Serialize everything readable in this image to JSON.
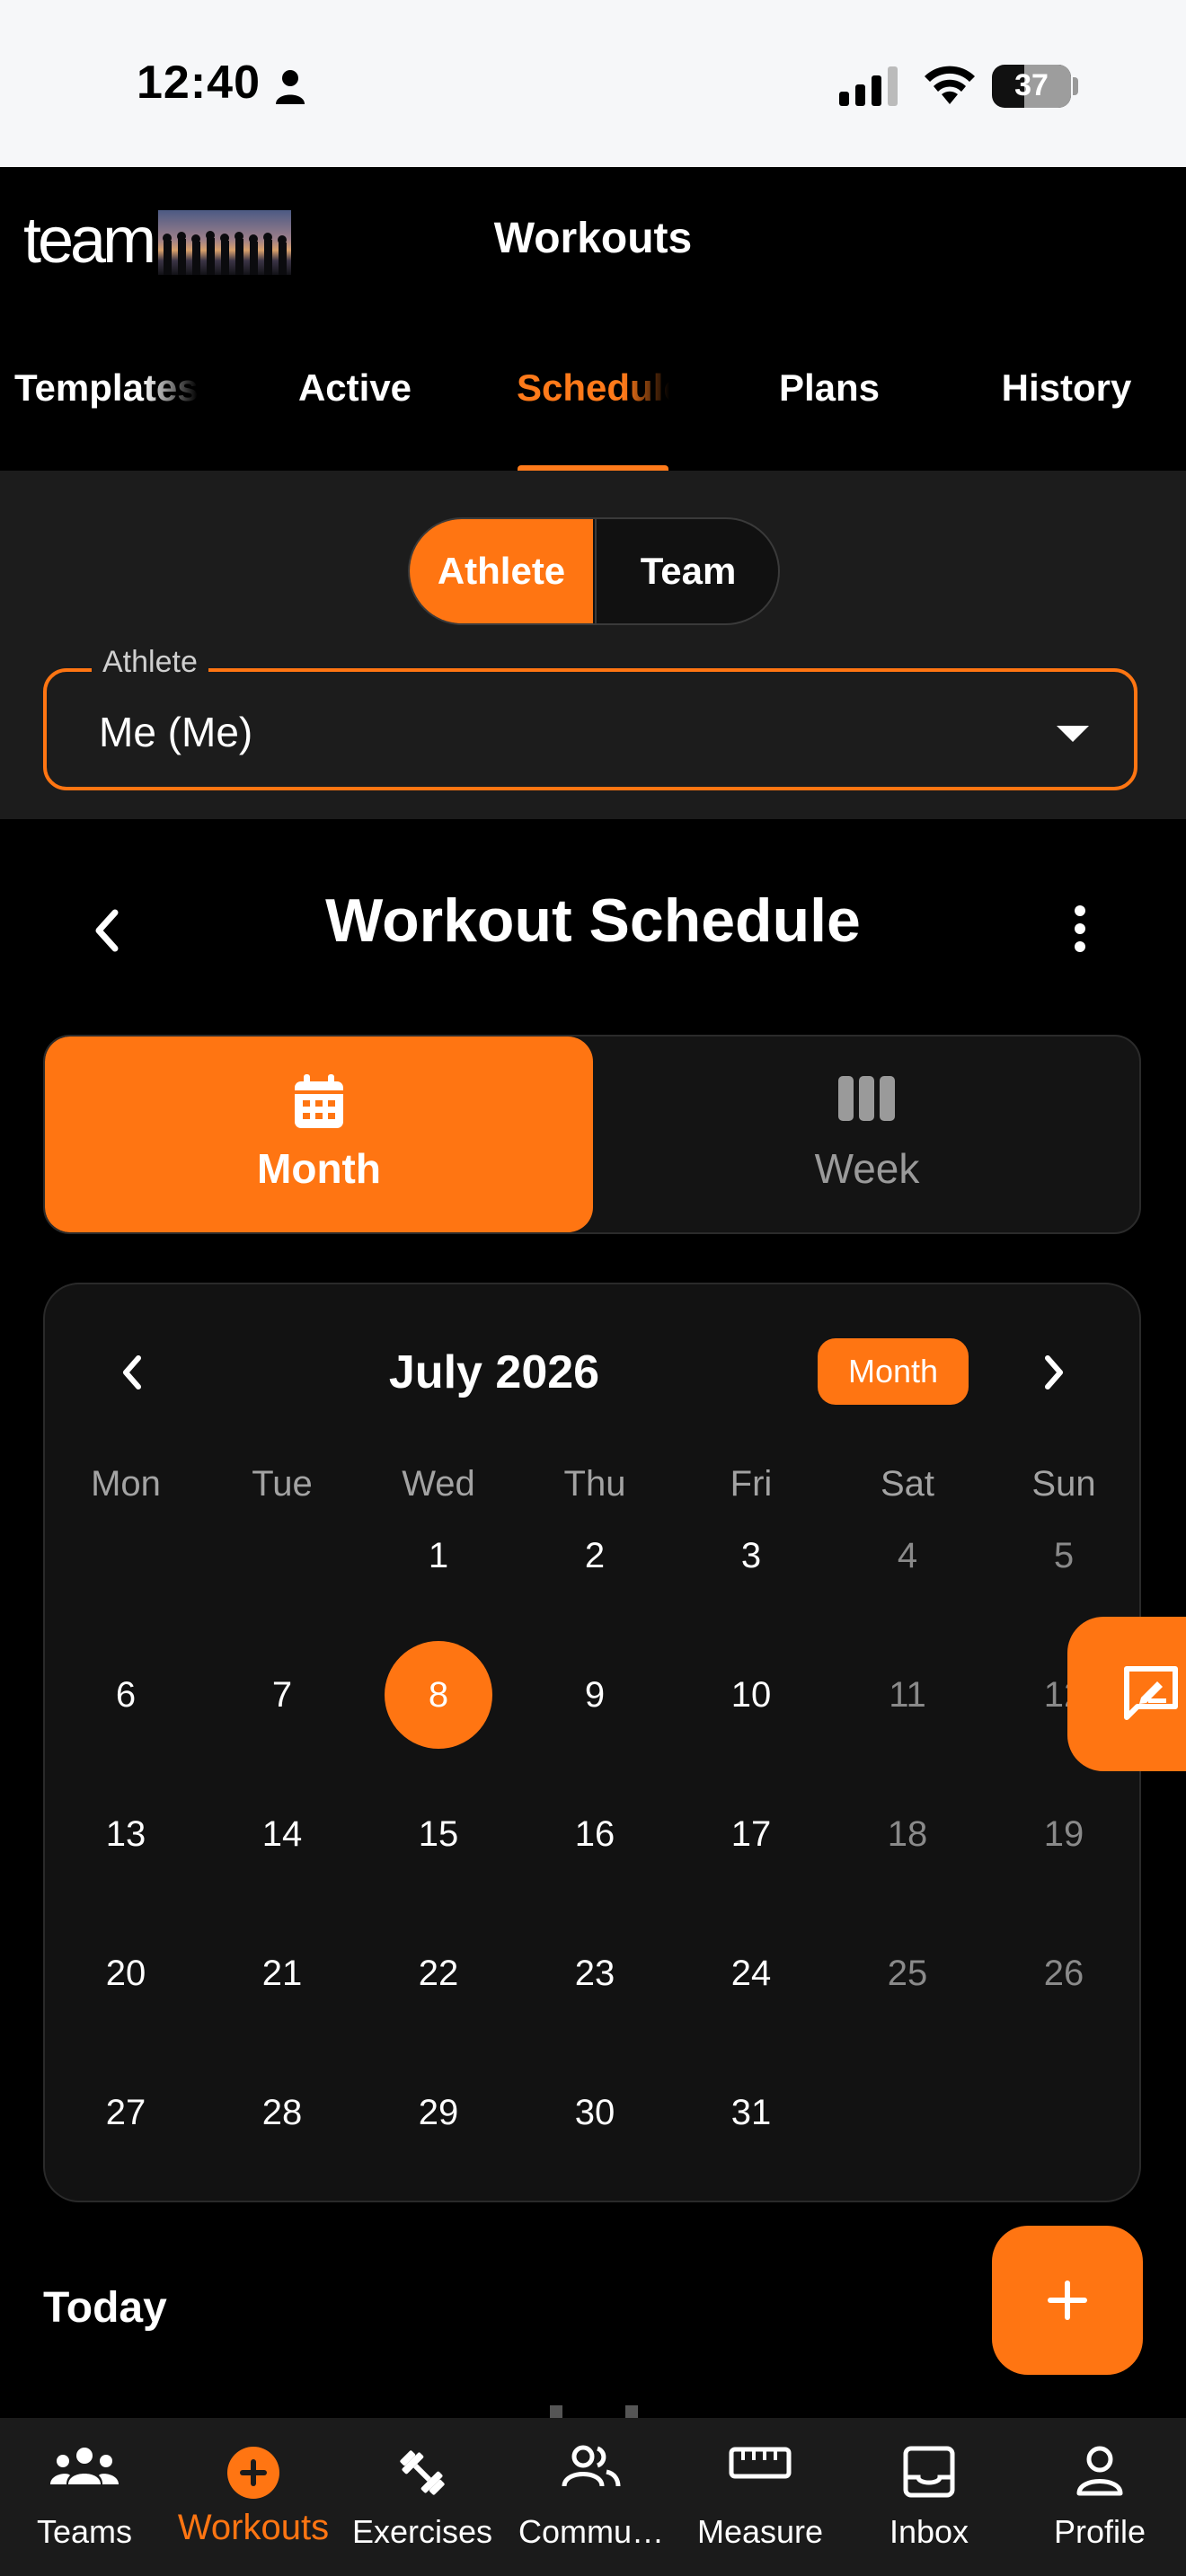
{
  "status_bar": {
    "time": "12:40",
    "battery": "37"
  },
  "header": {
    "logo_text": "team",
    "title": "Workouts"
  },
  "tabs": [
    {
      "label": "Templates"
    },
    {
      "label": "Active"
    },
    {
      "label": "Schedule"
    },
    {
      "label": "Plans"
    },
    {
      "label": "History"
    }
  ],
  "active_tab": "Schedule",
  "mode_toggle": {
    "athlete": "Athlete",
    "team": "Team",
    "selected": "Athlete"
  },
  "athlete_select": {
    "label": "Athlete",
    "value": "Me (Me)"
  },
  "schedule": {
    "title": "Workout Schedule"
  },
  "view_toggle": {
    "month": "Month",
    "week": "Week",
    "selected": "Month"
  },
  "calendar": {
    "month_label": "July 2026",
    "view_chip": "Month",
    "weekdays": [
      "Mon",
      "Tue",
      "Wed",
      "Thu",
      "Fri",
      "Sat",
      "Sun"
    ],
    "weeks": [
      [
        "",
        "",
        "1",
        "2",
        "3",
        "4",
        "5"
      ],
      [
        "6",
        "7",
        "8",
        "9",
        "10",
        "11",
        "12"
      ],
      [
        "13",
        "14",
        "15",
        "16",
        "17",
        "18",
        "19"
      ],
      [
        "20",
        "21",
        "22",
        "23",
        "24",
        "25",
        "26"
      ],
      [
        "27",
        "28",
        "29",
        "30",
        "31",
        "",
        ""
      ]
    ],
    "selected_day": "8",
    "accent": "#ff7512"
  },
  "today": {
    "label": "Today"
  },
  "bottom_nav": [
    {
      "label": "Teams",
      "icon": "teams-icon"
    },
    {
      "label": "Workouts",
      "icon": "workouts-icon"
    },
    {
      "label": "Exercises",
      "icon": "dumbbell-icon"
    },
    {
      "label": "Commu…",
      "icon": "community-icon"
    },
    {
      "label": "Measure",
      "icon": "ruler-icon"
    },
    {
      "label": "Inbox",
      "icon": "inbox-icon"
    },
    {
      "label": "Profile",
      "icon": "profile-icon"
    }
  ],
  "active_nav": "Workouts"
}
